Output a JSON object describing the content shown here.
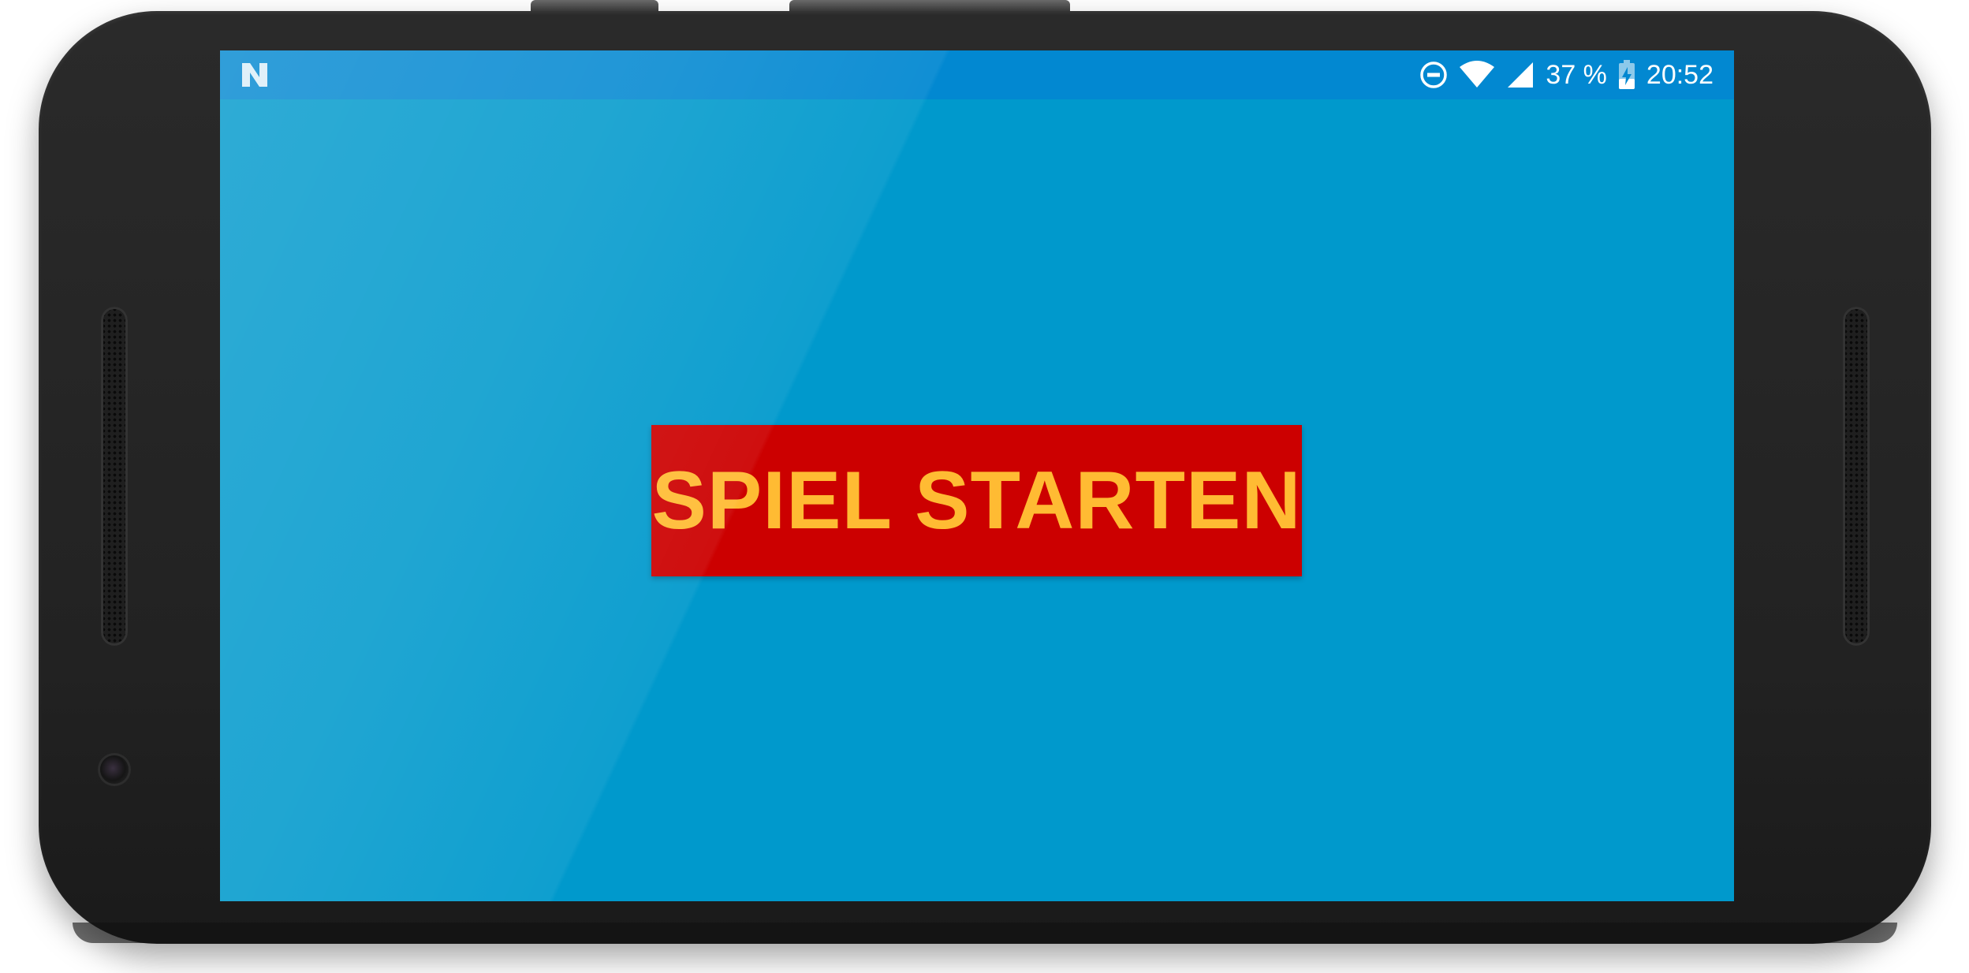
{
  "status_bar": {
    "notification_icon": "n-logo-icon",
    "icons": [
      "do-not-disturb-icon",
      "wifi-icon",
      "cell-signal-icon",
      "battery-charging-icon"
    ],
    "battery_text": "37 %",
    "time": "20:52"
  },
  "screen": {
    "background_color": "#0099cc",
    "status_bar_color": "#0288d1"
  },
  "start_button": {
    "label": "SPIEL STARTEN",
    "background_color": "#cc0000",
    "text_color": "#ffbb33"
  }
}
